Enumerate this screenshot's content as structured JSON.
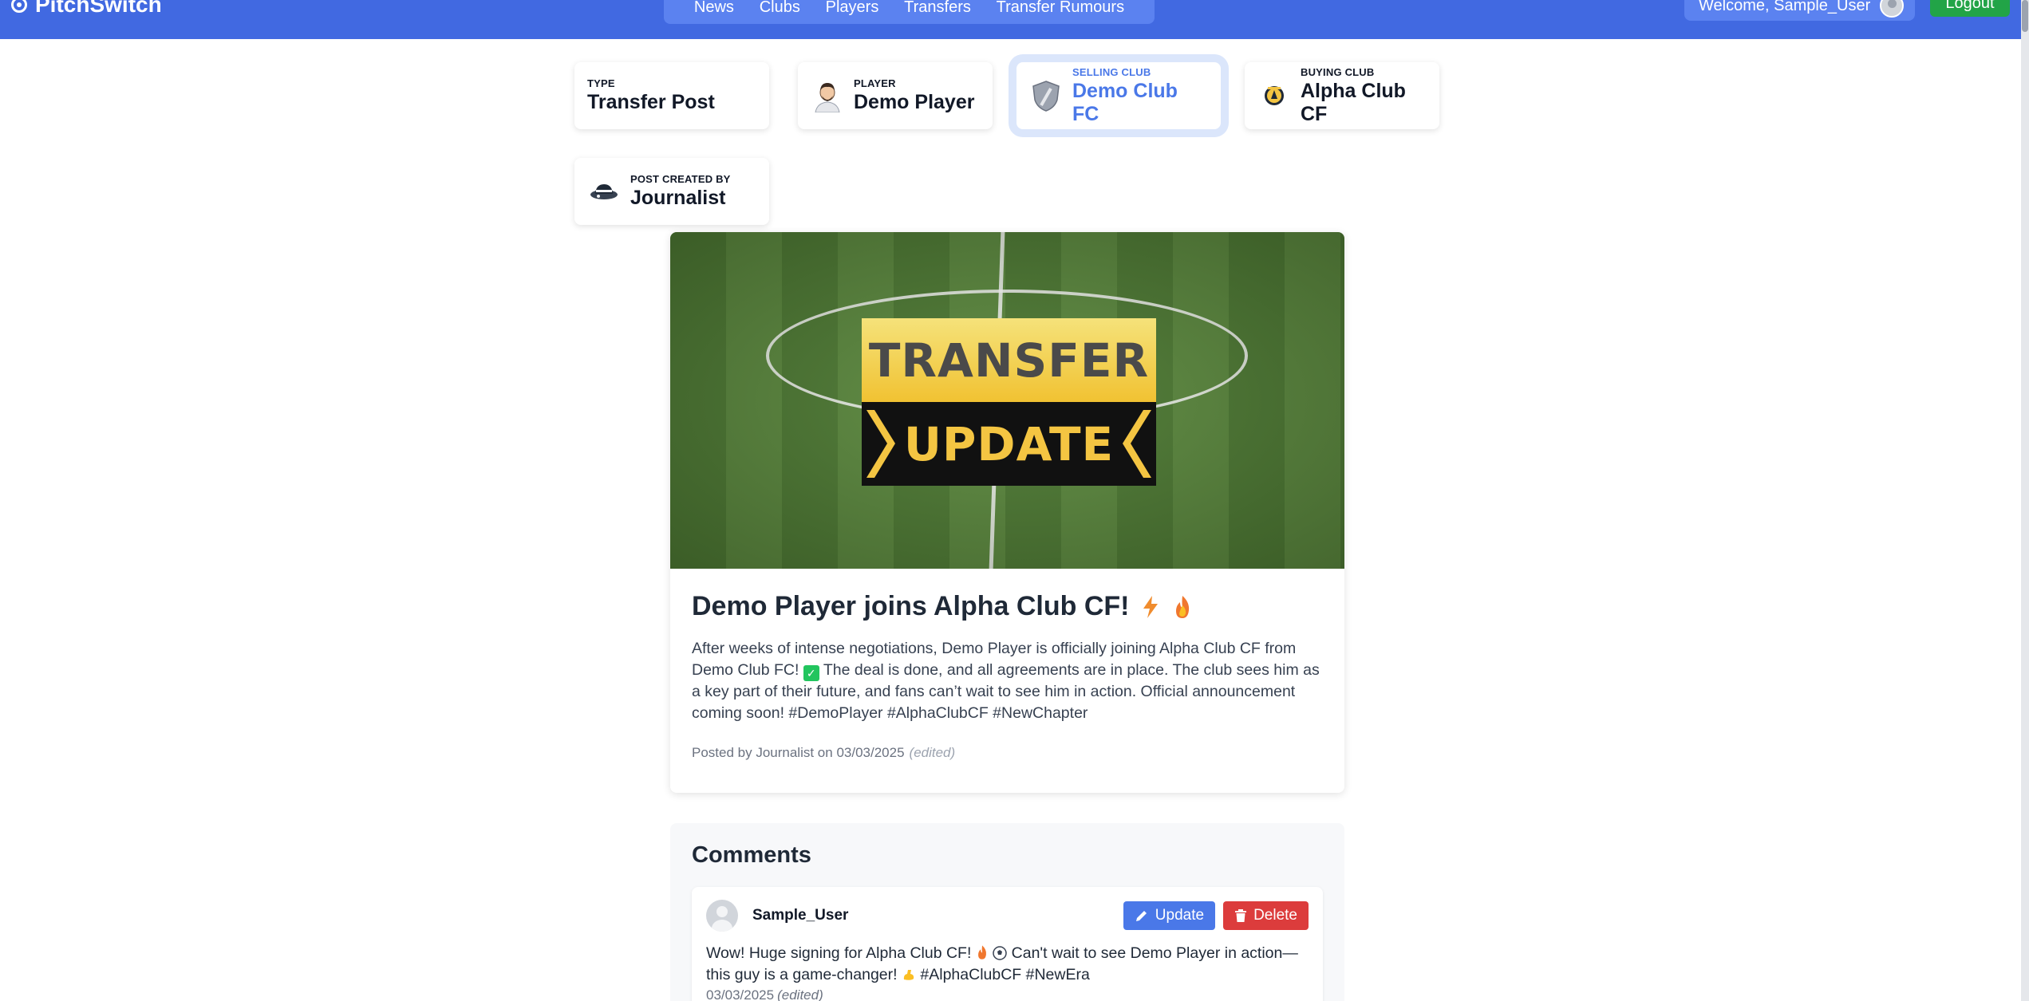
{
  "nav": {
    "brand": "PitchSwitch",
    "links": [
      "News",
      "Clubs",
      "Players",
      "Transfers",
      "Transfer Rumours"
    ],
    "welcome": "Welcome, Sample_User",
    "logout": "Logout"
  },
  "meta": {
    "type": {
      "label": "TYPE",
      "value": "Transfer Post"
    },
    "player": {
      "label": "PLAYER",
      "value": "Demo Player"
    },
    "selling": {
      "label": "SELLING CLUB",
      "value": "Demo Club FC"
    },
    "buying": {
      "label": "BUYING CLUB",
      "value": "Alpha Club CF"
    },
    "creator": {
      "label": "POST CREATED BY",
      "value": "Journalist"
    }
  },
  "article": {
    "banner_top": "TRANSFER",
    "banner_bottom": "UPDATE",
    "title": "Demo Player joins Alpha Club CF!",
    "text_1": "After weeks of intense negotiations, Demo Player is officially joining Alpha Club CF from Demo Club FC!",
    "text_2": "The deal is done, and all agreements are in place. The club sees him as a key part of their future, and fans can’t wait to see him in action. Official announcement coming soon! #DemoPlayer #AlphaClubCF #NewChapter",
    "posted": "Posted by Journalist on 03/03/2025",
    "edited": "(edited)"
  },
  "comments": {
    "title": "Comments",
    "items": [
      {
        "user": "Sample_User",
        "text_1": "Wow! Huge signing for Alpha Club CF!",
        "text_2": "Can't wait to see Demo Player in action—this guy is a game-changer!",
        "text_3": "#AlphaClubCF #NewEra",
        "date": "03/03/2025",
        "edited": "(edited)",
        "update_label": "Update",
        "delete_label": "Delete"
      }
    ]
  },
  "colors": {
    "navbar": "#4169e1",
    "accent": "#4a78e8",
    "logout": "#22a447",
    "delete": "#dc3c3c"
  }
}
